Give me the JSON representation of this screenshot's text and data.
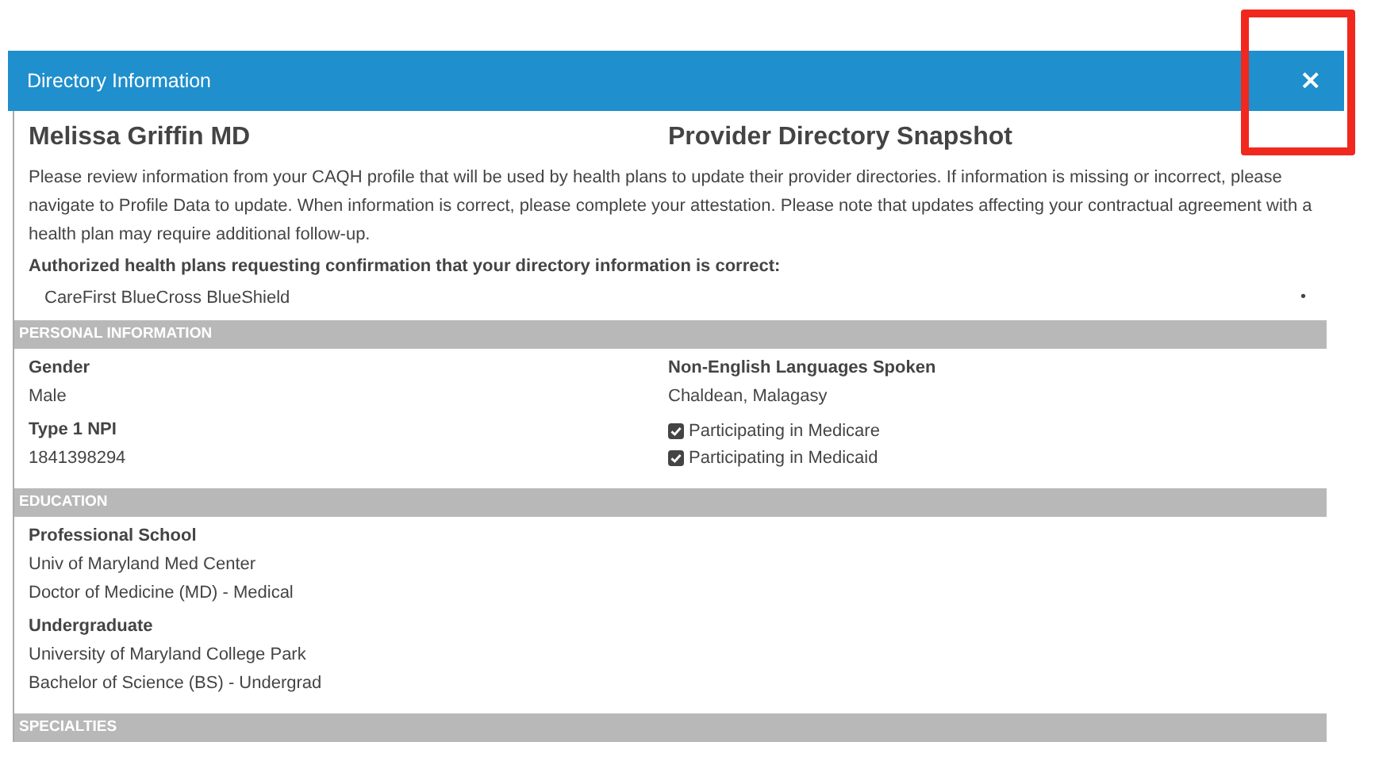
{
  "dialog": {
    "title": "Directory Information",
    "close": "×"
  },
  "provider_name": "Melissa Griffin MD",
  "snapshot_title": "Provider Directory Snapshot",
  "intro": "Please review information from your CAQH profile that will be used by health plans to update their provider directories. If information is missing or incorrect, please navigate to Profile Data to update. When information is correct, please complete your attestation. Please note that updates affecting your contractual agreement with a health plan may require additional follow-up.",
  "plans_heading": "Authorized health plans requesting confirmation that your directory information is correct:",
  "plans": [
    {
      "name": "CareFirst BlueCross BlueShield",
      "bullet": "•"
    }
  ],
  "sections": [
    {
      "title": "PERSONAL INFORMATION",
      "columns": [
        [
          {
            "kind": "field",
            "label": "Gender",
            "values": [
              "Male"
            ]
          },
          {
            "kind": "field",
            "label": "Type 1 NPI",
            "values": [
              "1841398294"
            ]
          }
        ],
        [
          {
            "kind": "field",
            "label": "Non-English Languages Spoken",
            "values": [
              "Chaldean, Malagasy"
            ]
          },
          {
            "kind": "checkbox",
            "label": "Participating in Medicare",
            "checked": true
          },
          {
            "kind": "checkbox",
            "label": "Participating in Medicaid",
            "checked": true
          }
        ]
      ]
    },
    {
      "title": "EDUCATION",
      "columns": [
        [
          {
            "kind": "field",
            "label": "Professional School",
            "values": [
              "Univ of Maryland Med Center",
              "Doctor of Medicine (MD) - Medical"
            ]
          },
          {
            "kind": "field",
            "label": "Undergraduate",
            "values": [
              "University of Maryland College Park",
              "Bachelor of Science (BS) - Undergrad"
            ]
          }
        ]
      ]
    },
    {
      "title": "SPECIALTIES"
    }
  ]
}
